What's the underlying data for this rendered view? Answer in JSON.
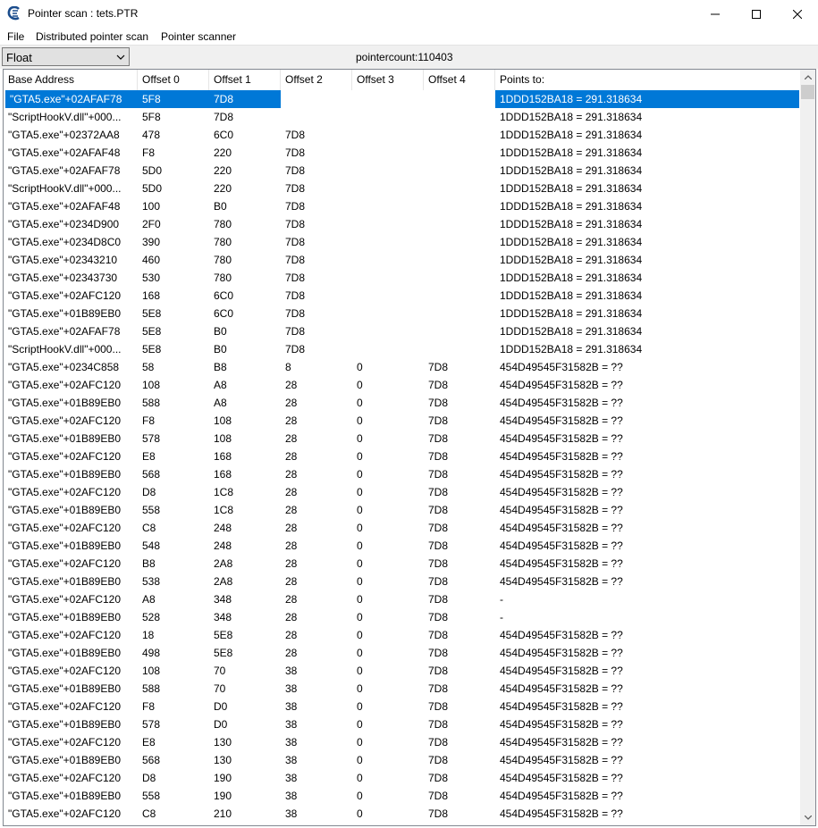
{
  "window": {
    "title": "Pointer scan : tets.PTR"
  },
  "menu": [
    "File",
    "Distributed pointer scan",
    "Pointer scanner"
  ],
  "toolbar": {
    "type_value": "Float",
    "pointercount": "pointercount:110403"
  },
  "columns": [
    "Base Address",
    "Offset 0",
    "Offset 1",
    "Offset 2",
    "Offset 3",
    "Offset 4",
    "Points to:"
  ],
  "rows": [
    [
      "\"GTA5.exe\"+02AFAF78",
      "5F8",
      "7D8",
      "",
      "",
      "",
      "1DDD152BA18 = 291.318634"
    ],
    [
      "\"ScriptHookV.dll\"+000...",
      "5F8",
      "7D8",
      "",
      "",
      "",
      "1DDD152BA18 = 291.318634"
    ],
    [
      "\"GTA5.exe\"+02372AA8",
      "478",
      "6C0",
      "7D8",
      "",
      "",
      "1DDD152BA18 = 291.318634"
    ],
    [
      "\"GTA5.exe\"+02AFAF48",
      "F8",
      "220",
      "7D8",
      "",
      "",
      "1DDD152BA18 = 291.318634"
    ],
    [
      "\"GTA5.exe\"+02AFAF78",
      "5D0",
      "220",
      "7D8",
      "",
      "",
      "1DDD152BA18 = 291.318634"
    ],
    [
      "\"ScriptHookV.dll\"+000...",
      "5D0",
      "220",
      "7D8",
      "",
      "",
      "1DDD152BA18 = 291.318634"
    ],
    [
      "\"GTA5.exe\"+02AFAF48",
      "100",
      "B0",
      "7D8",
      "",
      "",
      "1DDD152BA18 = 291.318634"
    ],
    [
      "\"GTA5.exe\"+0234D900",
      "2F0",
      "780",
      "7D8",
      "",
      "",
      "1DDD152BA18 = 291.318634"
    ],
    [
      "\"GTA5.exe\"+0234D8C0",
      "390",
      "780",
      "7D8",
      "",
      "",
      "1DDD152BA18 = 291.318634"
    ],
    [
      "\"GTA5.exe\"+02343210",
      "460",
      "780",
      "7D8",
      "",
      "",
      "1DDD152BA18 = 291.318634"
    ],
    [
      "\"GTA5.exe\"+02343730",
      "530",
      "780",
      "7D8",
      "",
      "",
      "1DDD152BA18 = 291.318634"
    ],
    [
      "\"GTA5.exe\"+02AFC120",
      "168",
      "6C0",
      "7D8",
      "",
      "",
      "1DDD152BA18 = 291.318634"
    ],
    [
      "\"GTA5.exe\"+01B89EB0",
      "5E8",
      "6C0",
      "7D8",
      "",
      "",
      "1DDD152BA18 = 291.318634"
    ],
    [
      "\"GTA5.exe\"+02AFAF78",
      "5E8",
      "B0",
      "7D8",
      "",
      "",
      "1DDD152BA18 = 291.318634"
    ],
    [
      "\"ScriptHookV.dll\"+000...",
      "5E8",
      "B0",
      "7D8",
      "",
      "",
      "1DDD152BA18 = 291.318634"
    ],
    [
      "\"GTA5.exe\"+0234C858",
      "58",
      "B8",
      "8",
      "0",
      "7D8",
      "454D49545F31582B = ??"
    ],
    [
      "\"GTA5.exe\"+02AFC120",
      "108",
      "A8",
      "28",
      "0",
      "7D8",
      "454D49545F31582B = ??"
    ],
    [
      "\"GTA5.exe\"+01B89EB0",
      "588",
      "A8",
      "28",
      "0",
      "7D8",
      "454D49545F31582B = ??"
    ],
    [
      "\"GTA5.exe\"+02AFC120",
      "F8",
      "108",
      "28",
      "0",
      "7D8",
      "454D49545F31582B = ??"
    ],
    [
      "\"GTA5.exe\"+01B89EB0",
      "578",
      "108",
      "28",
      "0",
      "7D8",
      "454D49545F31582B = ??"
    ],
    [
      "\"GTA5.exe\"+02AFC120",
      "E8",
      "168",
      "28",
      "0",
      "7D8",
      "454D49545F31582B = ??"
    ],
    [
      "\"GTA5.exe\"+01B89EB0",
      "568",
      "168",
      "28",
      "0",
      "7D8",
      "454D49545F31582B = ??"
    ],
    [
      "\"GTA5.exe\"+02AFC120",
      "D8",
      "1C8",
      "28",
      "0",
      "7D8",
      "454D49545F31582B = ??"
    ],
    [
      "\"GTA5.exe\"+01B89EB0",
      "558",
      "1C8",
      "28",
      "0",
      "7D8",
      "454D49545F31582B = ??"
    ],
    [
      "\"GTA5.exe\"+02AFC120",
      "C8",
      "248",
      "28",
      "0",
      "7D8",
      "454D49545F31582B = ??"
    ],
    [
      "\"GTA5.exe\"+01B89EB0",
      "548",
      "248",
      "28",
      "0",
      "7D8",
      "454D49545F31582B = ??"
    ],
    [
      "\"GTA5.exe\"+02AFC120",
      "B8",
      "2A8",
      "28",
      "0",
      "7D8",
      "454D49545F31582B = ??"
    ],
    [
      "\"GTA5.exe\"+01B89EB0",
      "538",
      "2A8",
      "28",
      "0",
      "7D8",
      "454D49545F31582B = ??"
    ],
    [
      "\"GTA5.exe\"+02AFC120",
      "A8",
      "348",
      "28",
      "0",
      "7D8",
      "-"
    ],
    [
      "\"GTA5.exe\"+01B89EB0",
      "528",
      "348",
      "28",
      "0",
      "7D8",
      "-"
    ],
    [
      "\"GTA5.exe\"+02AFC120",
      "18",
      "5E8",
      "28",
      "0",
      "7D8",
      "454D49545F31582B = ??"
    ],
    [
      "\"GTA5.exe\"+01B89EB0",
      "498",
      "5E8",
      "28",
      "0",
      "7D8",
      "454D49545F31582B = ??"
    ],
    [
      "\"GTA5.exe\"+02AFC120",
      "108",
      "70",
      "38",
      "0",
      "7D8",
      "454D49545F31582B = ??"
    ],
    [
      "\"GTA5.exe\"+01B89EB0",
      "588",
      "70",
      "38",
      "0",
      "7D8",
      "454D49545F31582B = ??"
    ],
    [
      "\"GTA5.exe\"+02AFC120",
      "F8",
      "D0",
      "38",
      "0",
      "7D8",
      "454D49545F31582B = ??"
    ],
    [
      "\"GTA5.exe\"+01B89EB0",
      "578",
      "D0",
      "38",
      "0",
      "7D8",
      "454D49545F31582B = ??"
    ],
    [
      "\"GTA5.exe\"+02AFC120",
      "E8",
      "130",
      "38",
      "0",
      "7D8",
      "454D49545F31582B = ??"
    ],
    [
      "\"GTA5.exe\"+01B89EB0",
      "568",
      "130",
      "38",
      "0",
      "7D8",
      "454D49545F31582B = ??"
    ],
    [
      "\"GTA5.exe\"+02AFC120",
      "D8",
      "190",
      "38",
      "0",
      "7D8",
      "454D49545F31582B = ??"
    ],
    [
      "\"GTA5.exe\"+01B89EB0",
      "558",
      "190",
      "38",
      "0",
      "7D8",
      "454D49545F31582B = ??"
    ],
    [
      "\"GTA5.exe\"+02AFC120",
      "C8",
      "210",
      "38",
      "0",
      "7D8",
      "454D49545F31582B = ??"
    ]
  ],
  "selected_row": 0
}
